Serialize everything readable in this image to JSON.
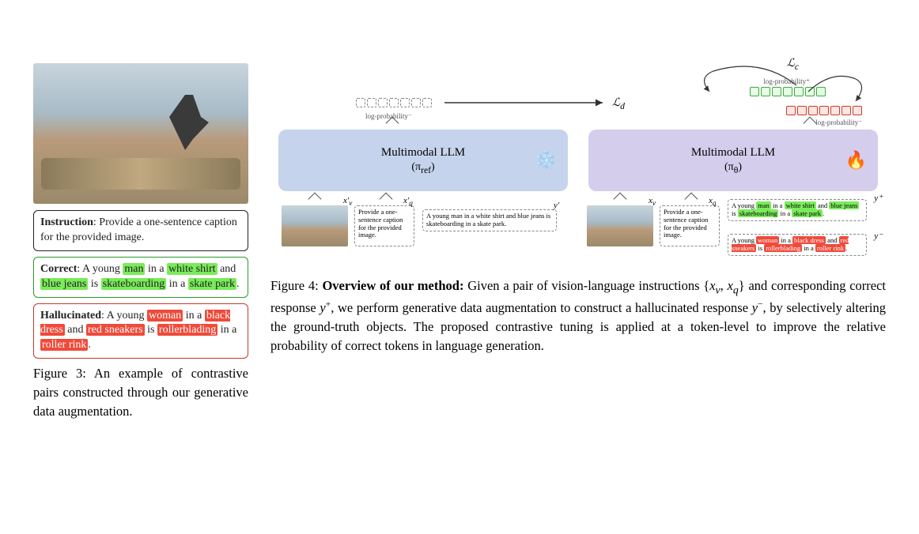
{
  "fig3": {
    "instruction_label": "Instruction",
    "instruction_text": ": Provide a one-sentence caption for the provided image.",
    "correct_label": "Correct",
    "correct_pre": ": A young ",
    "w_man": "man",
    "t_in_a": " in a ",
    "w_white_shirt": "white shirt",
    "t_and": " and ",
    "w_blue_jeans": "blue jeans",
    "t_is": " is ",
    "w_skateboarding": "skateboarding",
    "t_in_a2": " in a ",
    "w_skate_park": "skate park",
    "period": ".",
    "halluc_label": "Hallucinated",
    "halluc_pre": ": A young ",
    "w_woman": "woman",
    "w_black_dress": "black dress",
    "w_red_sneakers": "red sneakers",
    "w_rollerblading": "rollerblading",
    "w_roller_rink": "roller rink",
    "caption": "Figure 3: An example of contrastive pairs constructed through our generative data augmentation."
  },
  "fig4": {
    "llm_title": "Multimodal LLM",
    "pi_ref": "(π",
    "pi_ref_sub": "ref",
    "pi_ref_close": ")",
    "pi_theta": "(π",
    "pi_theta_sub": "θ",
    "pi_theta_close": ")",
    "lp_neg": "log-probability⁻",
    "lp_pos": "log-probability⁺",
    "loss_d": "ℒ_d",
    "loss_c": "ℒ_c",
    "xv_r": "x′_v",
    "xq_r": "x′_q",
    "y_r": "y′",
    "xv": "x_v",
    "xq": "x_q",
    "y_pos": "y⁺",
    "y_neg": "y⁻",
    "prompt_text": "Provide a one-sentence caption for the provided image.",
    "resp_pos_1": "A young ",
    "resp_pos_2": " in a ",
    "resp_pos_3": " and ",
    "resp_pos_4": " is ",
    "resp_pos_5": " in a ",
    "resp_neg_pre": "A young ",
    "caption_lead": "Figure 4: ",
    "caption_bold": "Overview of our method:",
    "caption_rest": " Given a pair of vision-language instructions {x_v, x_q} and corresponding correct response y⁺, we perform generative data augmentation to construct a hallucinated response y⁻, by selectively altering the ground-truth objects. The proposed contrastive tuning is applied at a token-level to improve the relative probability of correct tokens in language generation."
  }
}
